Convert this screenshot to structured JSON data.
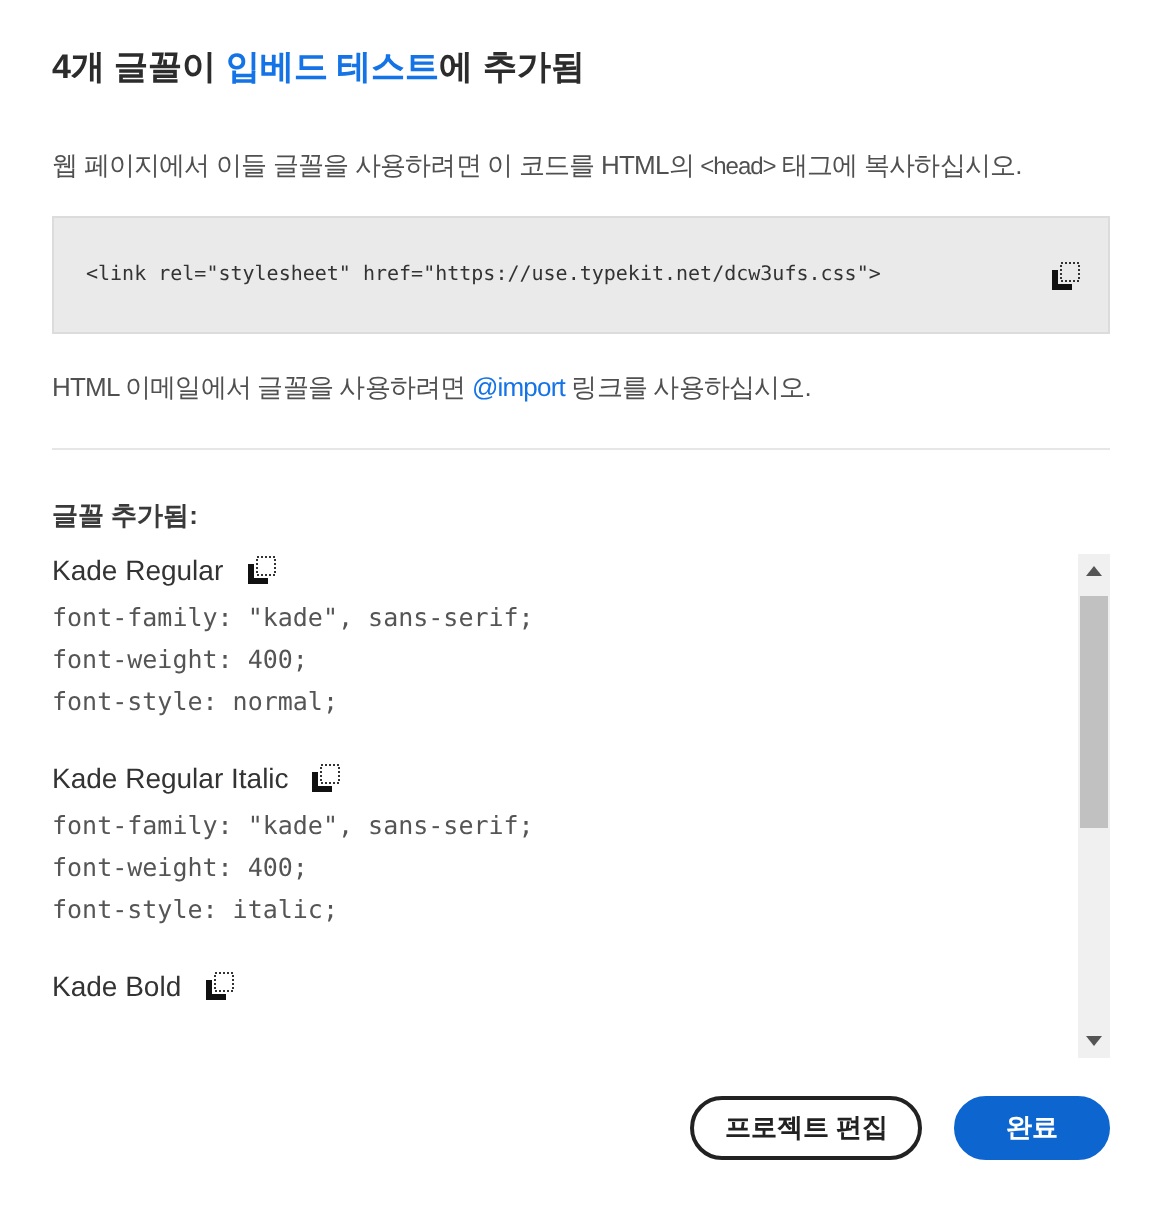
{
  "title": {
    "before": "4개 글꼴이 ",
    "link": "입베드 테스트",
    "after": "에 추가됨"
  },
  "web_instruction": {
    "before": "웹 페이지에서 이들 글꼴을 사용하려면 이 코드를 HTML의 ",
    "code": "<head>",
    "after": " 태그에 복사하십시오."
  },
  "embed_code": "<link rel=\"stylesheet\" href=\"https://use.typekit.net/dcw3ufs.css\">",
  "email_instruction": {
    "before": "HTML 이메일에서 글꼴을 사용하려면 ",
    "link": "@import",
    "after": " 링크를 사용하십시오."
  },
  "fonts_heading": "글꼴 추가됨:",
  "fonts": [
    {
      "name": "Kade Regular",
      "css": [
        "font-family: \"kade\", sans-serif;",
        "font-weight: 400;",
        "font-style: normal;"
      ]
    },
    {
      "name": "Kade Regular Italic",
      "css": [
        "font-family: \"kade\", sans-serif;",
        "font-weight: 400;",
        "font-style: italic;"
      ]
    },
    {
      "name": "Kade Bold"
    }
  ],
  "buttons": [
    {
      "label": "프로젝트 편집",
      "kind": "secondary"
    },
    {
      "label": "완료",
      "kind": "primary"
    }
  ]
}
